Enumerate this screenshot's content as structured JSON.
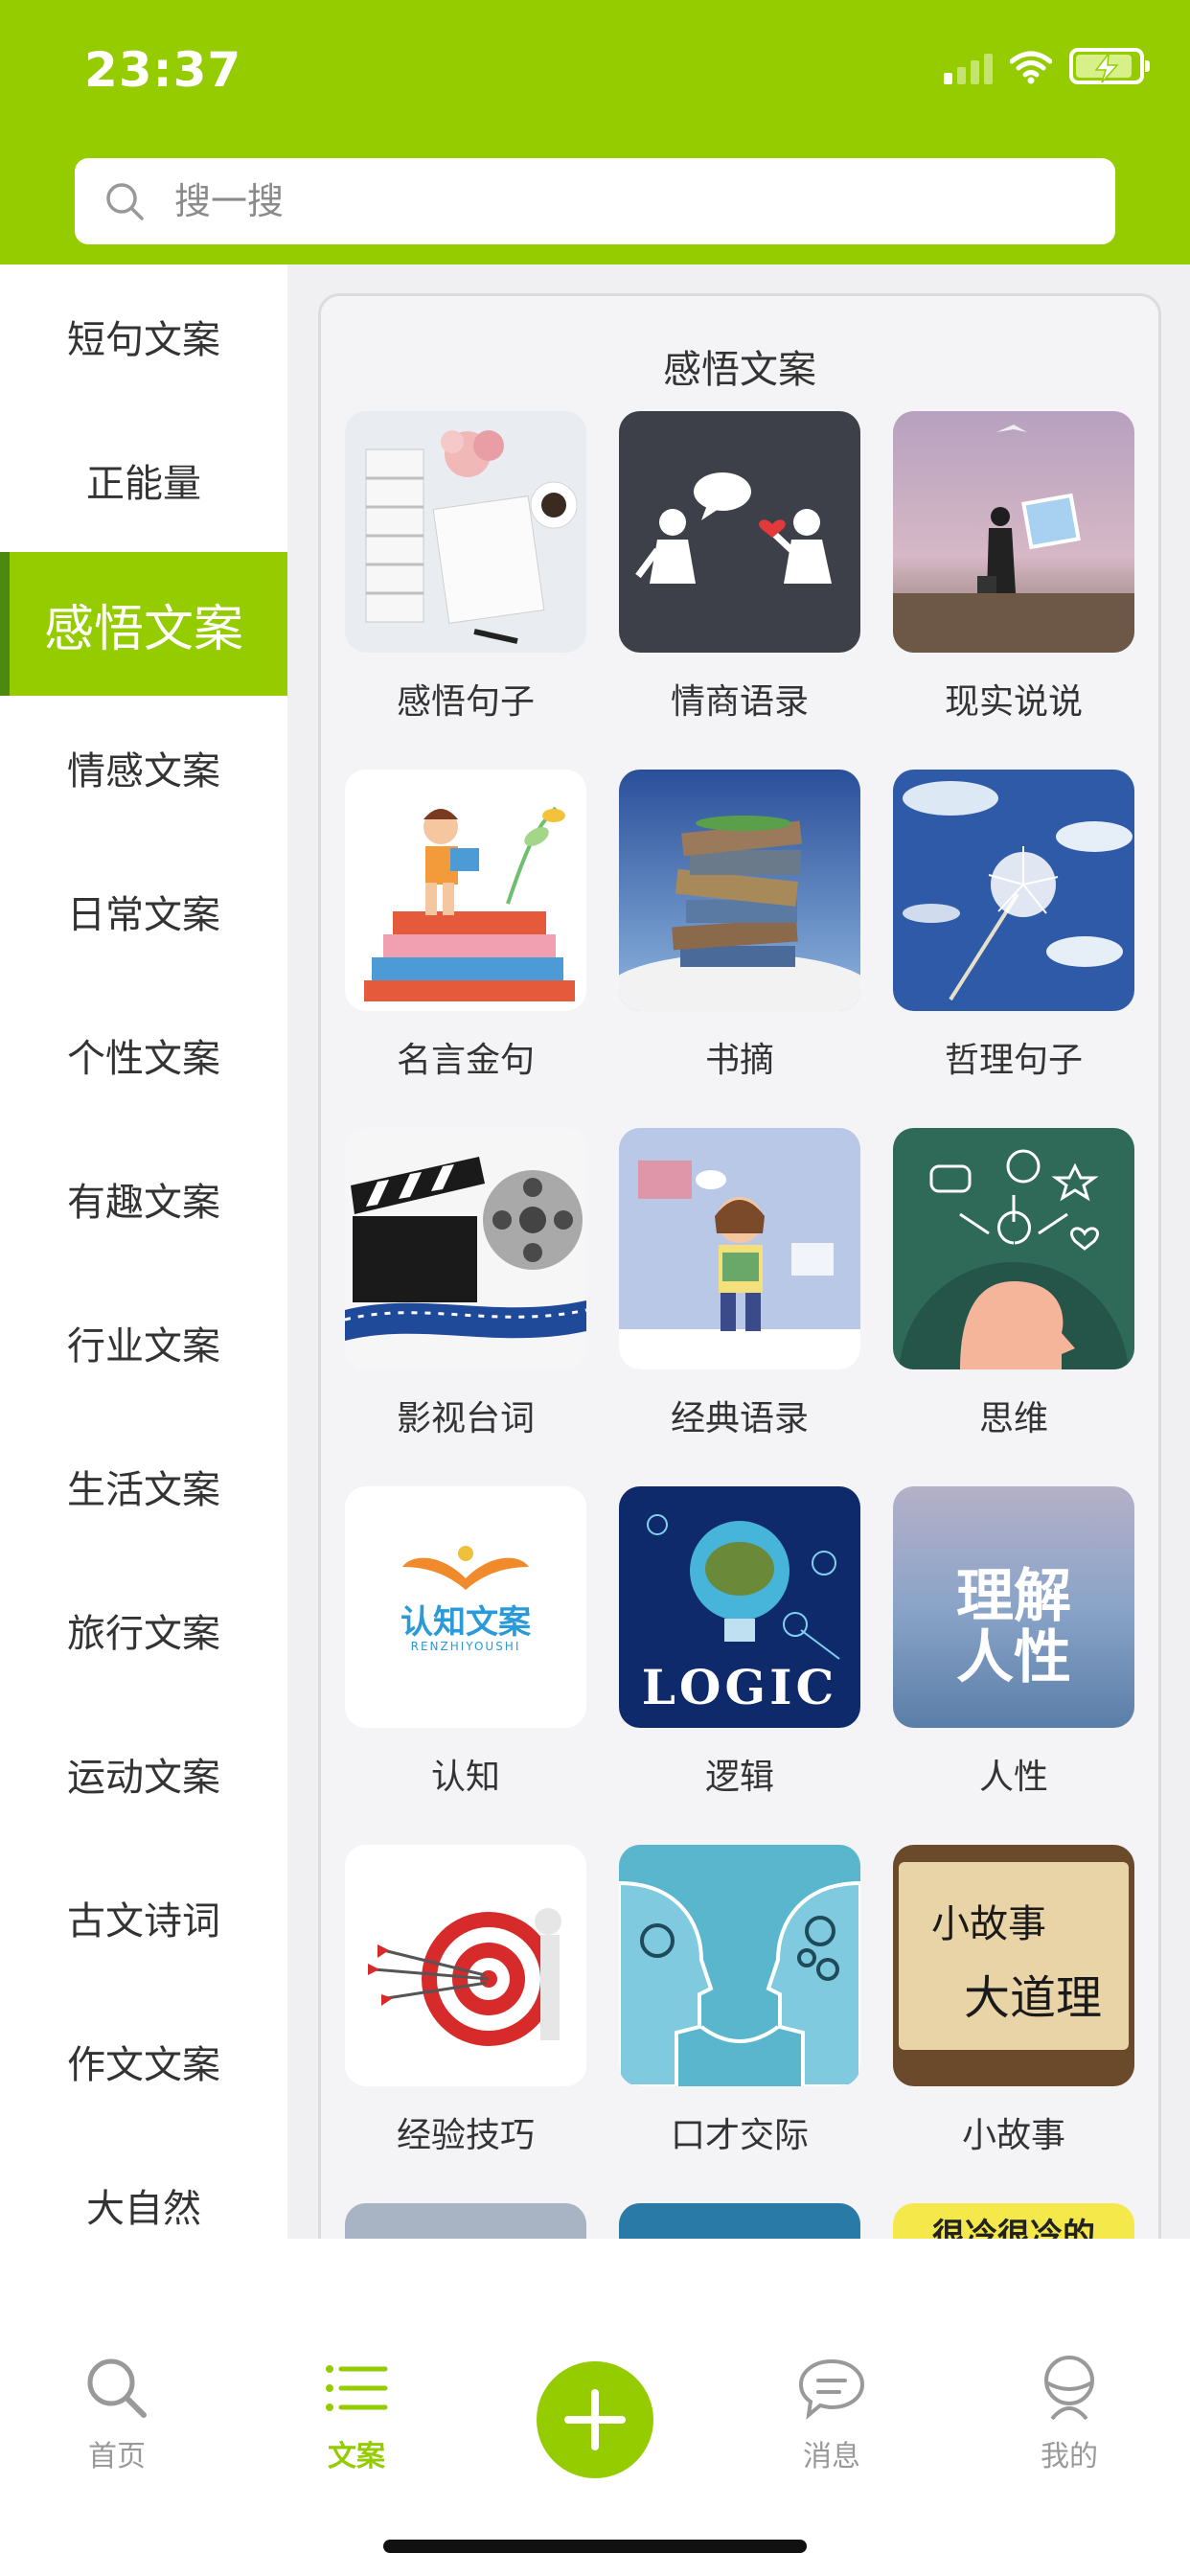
{
  "status": {
    "time": "23:37"
  },
  "search": {
    "placeholder": "搜一搜"
  },
  "sidebar": {
    "items": [
      {
        "label": "短句文案"
      },
      {
        "label": "正能量"
      },
      {
        "label": "感悟文案",
        "active": true
      },
      {
        "label": "情感文案"
      },
      {
        "label": "日常文案"
      },
      {
        "label": "个性文案"
      },
      {
        "label": "有趣文案"
      },
      {
        "label": "行业文案"
      },
      {
        "label": "生活文案"
      },
      {
        "label": "旅行文案"
      },
      {
        "label": "运动文案"
      },
      {
        "label": "古文诗词"
      },
      {
        "label": "作文文案"
      },
      {
        "label": "大自然"
      }
    ]
  },
  "main": {
    "title": "感悟文案",
    "tiles": [
      {
        "label": "感悟句子",
        "icon": "books-flowers-image"
      },
      {
        "label": "情商语录",
        "icon": "people-talking-image"
      },
      {
        "label": "现实说说",
        "icon": "girl-with-frame-image"
      },
      {
        "label": "名言金句",
        "icon": "girl-reading-on-books-image"
      },
      {
        "label": "书摘",
        "icon": "book-stack-sky-image"
      },
      {
        "label": "哲理句子",
        "icon": "dandelion-sky-image"
      },
      {
        "label": "影视台词",
        "icon": "film-clapper-reel-image"
      },
      {
        "label": "经典语录",
        "icon": "child-reading-image"
      },
      {
        "label": "思维",
        "icon": "head-ideas-image"
      },
      {
        "label": "认知",
        "icon": "renzhi-logo-image"
      },
      {
        "label": "逻辑",
        "icon": "logic-bulb-image"
      },
      {
        "label": "人性",
        "icon": "understand-humanity-image"
      },
      {
        "label": "经验技巧",
        "icon": "target-darts-image"
      },
      {
        "label": "口才交际",
        "icon": "two-heads-gears-image"
      },
      {
        "label": "小故事",
        "icon": "scroll-calligraphy-image"
      }
    ],
    "partial_row_text": "很冷很冷的"
  },
  "thumb_text": {
    "renzhi_title": "认知文案",
    "renzhi_sub": "RENZHIYOUSHI",
    "logic_word": "LOGIC",
    "humanity_line1": "理解",
    "humanity_line2": "人性",
    "story_line1": "小故事",
    "story_line2": "大道理"
  },
  "tabbar": {
    "tabs": [
      {
        "label": "首页",
        "icon": "search-icon"
      },
      {
        "label": "文案",
        "icon": "list-icon",
        "active": true
      },
      {
        "label": "消息",
        "icon": "chat-bubble-icon"
      },
      {
        "label": "我的",
        "icon": "profile-icon"
      }
    ]
  },
  "colors": {
    "accent": "#94cc00",
    "accent_dark": "#4a8a10",
    "bg": "#f0f0f2"
  }
}
